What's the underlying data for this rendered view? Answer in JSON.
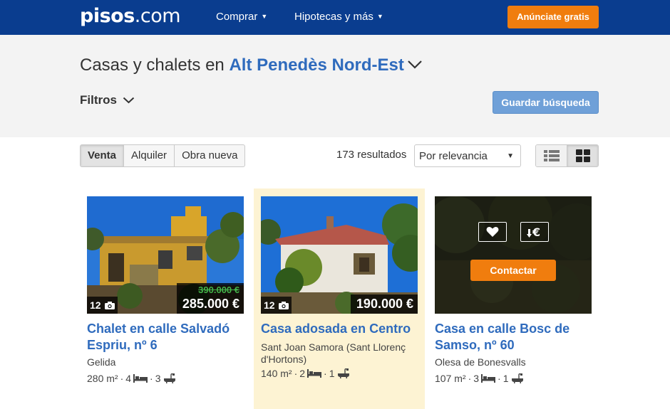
{
  "header": {
    "logo_bold": "pisos",
    "logo_light": ".com",
    "nav": [
      {
        "label": "Comprar"
      },
      {
        "label": "Hipotecas y más"
      }
    ],
    "cta_label": "Anúnciate gratis"
  },
  "search": {
    "title_prefix": "Casas y chalets en",
    "location": "Alt Penedès Nord-Est",
    "filters_label": "Filtros",
    "save_label": "Guardar búsqueda"
  },
  "toolbar": {
    "tabs": [
      {
        "label": "Venta",
        "active": true
      },
      {
        "label": "Alquiler",
        "active": false
      },
      {
        "label": "Obra nueva",
        "active": false
      }
    ],
    "results": "173 resultados",
    "sort_value": "Por relevancia"
  },
  "listings": [
    {
      "photo_count": "12",
      "old_price": "390.000 €",
      "price": "285.000 €",
      "title": "Chalet en calle Salvadó Espriu, nº 6",
      "location": "Gelida",
      "area": "280 m²",
      "rooms": "4",
      "baths": "3"
    },
    {
      "photo_count": "12",
      "price": "190.000 €",
      "title": "Casa adosada en Centro",
      "location": "Sant Joan Samora (Sant Llorenç d'Hortons)",
      "area": "140 m²",
      "rooms": "2",
      "baths": "1"
    },
    {
      "contact_label": "Contactar",
      "title": "Casa en calle Bosc de Samso, nº 60",
      "location": "Olesa de Bonesvalls",
      "area": "107 m²",
      "rooms": "3",
      "baths": "1"
    }
  ],
  "colors": {
    "header_bg": "#0a3d8f",
    "accent_orange": "#f07d0e",
    "link_blue": "#2f6bbd",
    "highlight_bg": "#fdf3d3",
    "old_price_green": "#43b249"
  }
}
